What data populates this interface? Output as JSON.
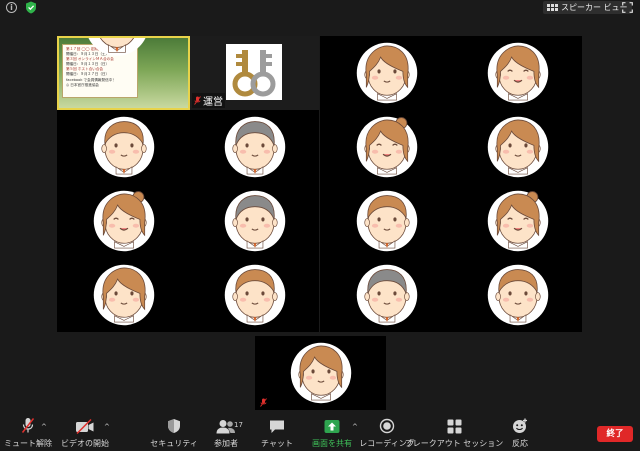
{
  "topbar": {
    "speaker_view_label": "スピーカー ビュー"
  },
  "tiles": [
    {
      "id": 1,
      "name": "日本官庁推進協会",
      "kind": "flyer"
    },
    {
      "id": 2,
      "name": "運営",
      "kind": "logo",
      "muted": true
    },
    {
      "id": 3,
      "kind": "face",
      "variant": "woman"
    },
    {
      "id": 4,
      "kind": "face",
      "variant": "woman-smile"
    },
    {
      "id": 5,
      "kind": "face",
      "variant": "boy"
    },
    {
      "id": 6,
      "kind": "face",
      "variant": "man-gray"
    },
    {
      "id": 7,
      "kind": "face",
      "variant": "woman-bun-smile"
    },
    {
      "id": 8,
      "kind": "face",
      "variant": "woman"
    },
    {
      "id": 9,
      "kind": "face",
      "variant": "woman-bun-smile"
    },
    {
      "id": 10,
      "kind": "face",
      "variant": "man-gray"
    },
    {
      "id": 11,
      "kind": "face",
      "variant": "boy"
    },
    {
      "id": 12,
      "kind": "face",
      "variant": "woman-bun-smile"
    },
    {
      "id": 13,
      "kind": "face",
      "variant": "woman"
    },
    {
      "id": 14,
      "kind": "face",
      "variant": "boy"
    },
    {
      "id": 15,
      "kind": "face",
      "variant": "man-gray"
    },
    {
      "id": 16,
      "kind": "face",
      "variant": "boy"
    },
    {
      "id": 17,
      "kind": "face",
      "variant": "woman",
      "muted": true
    }
  ],
  "flyer": {
    "lines": [
      {
        "text": "第１７回 ◯◯ 定期大会",
        "highlight": true
      },
      {
        "text": "開催日：９月１３日（土）",
        "highlight": false
      },
      {
        "text": "第３回 オンラインＭＡ合の会",
        "highlight": true
      },
      {
        "text": "開催日：９月１３日（日）",
        "highlight": false
      },
      {
        "text": "第５回 ホスト合い合会",
        "highlight": true
      },
      {
        "text": "開催日：９月２７日（日）",
        "highlight": false
      },
      {
        "text": "facebook で会員情報発信中！",
        "highlight": false
      },
      {
        "text": "◎ 日本官庁推進協会",
        "highlight": false
      }
    ]
  },
  "toolbar": {
    "items": [
      {
        "key": "mute",
        "label": "ミュート解除"
      },
      {
        "key": "video",
        "label": "ビデオの開始"
      },
      {
        "key": "security",
        "label": "セキュリティ"
      },
      {
        "key": "participants",
        "label": "参加者",
        "count": "17"
      },
      {
        "key": "chat",
        "label": "チャット"
      },
      {
        "key": "share",
        "label": "画面を共有"
      },
      {
        "key": "record",
        "label": "レコーディング"
      },
      {
        "key": "breakout",
        "label": "ブレークアウト セッション"
      },
      {
        "key": "reactions",
        "label": "反応"
      }
    ],
    "end_label": "終了"
  },
  "colors": {
    "background": "#1a1a1a",
    "tile": "#000000",
    "share_green": "#3fc259",
    "end_red": "#e02828",
    "muted_red": "#e0302d"
  }
}
